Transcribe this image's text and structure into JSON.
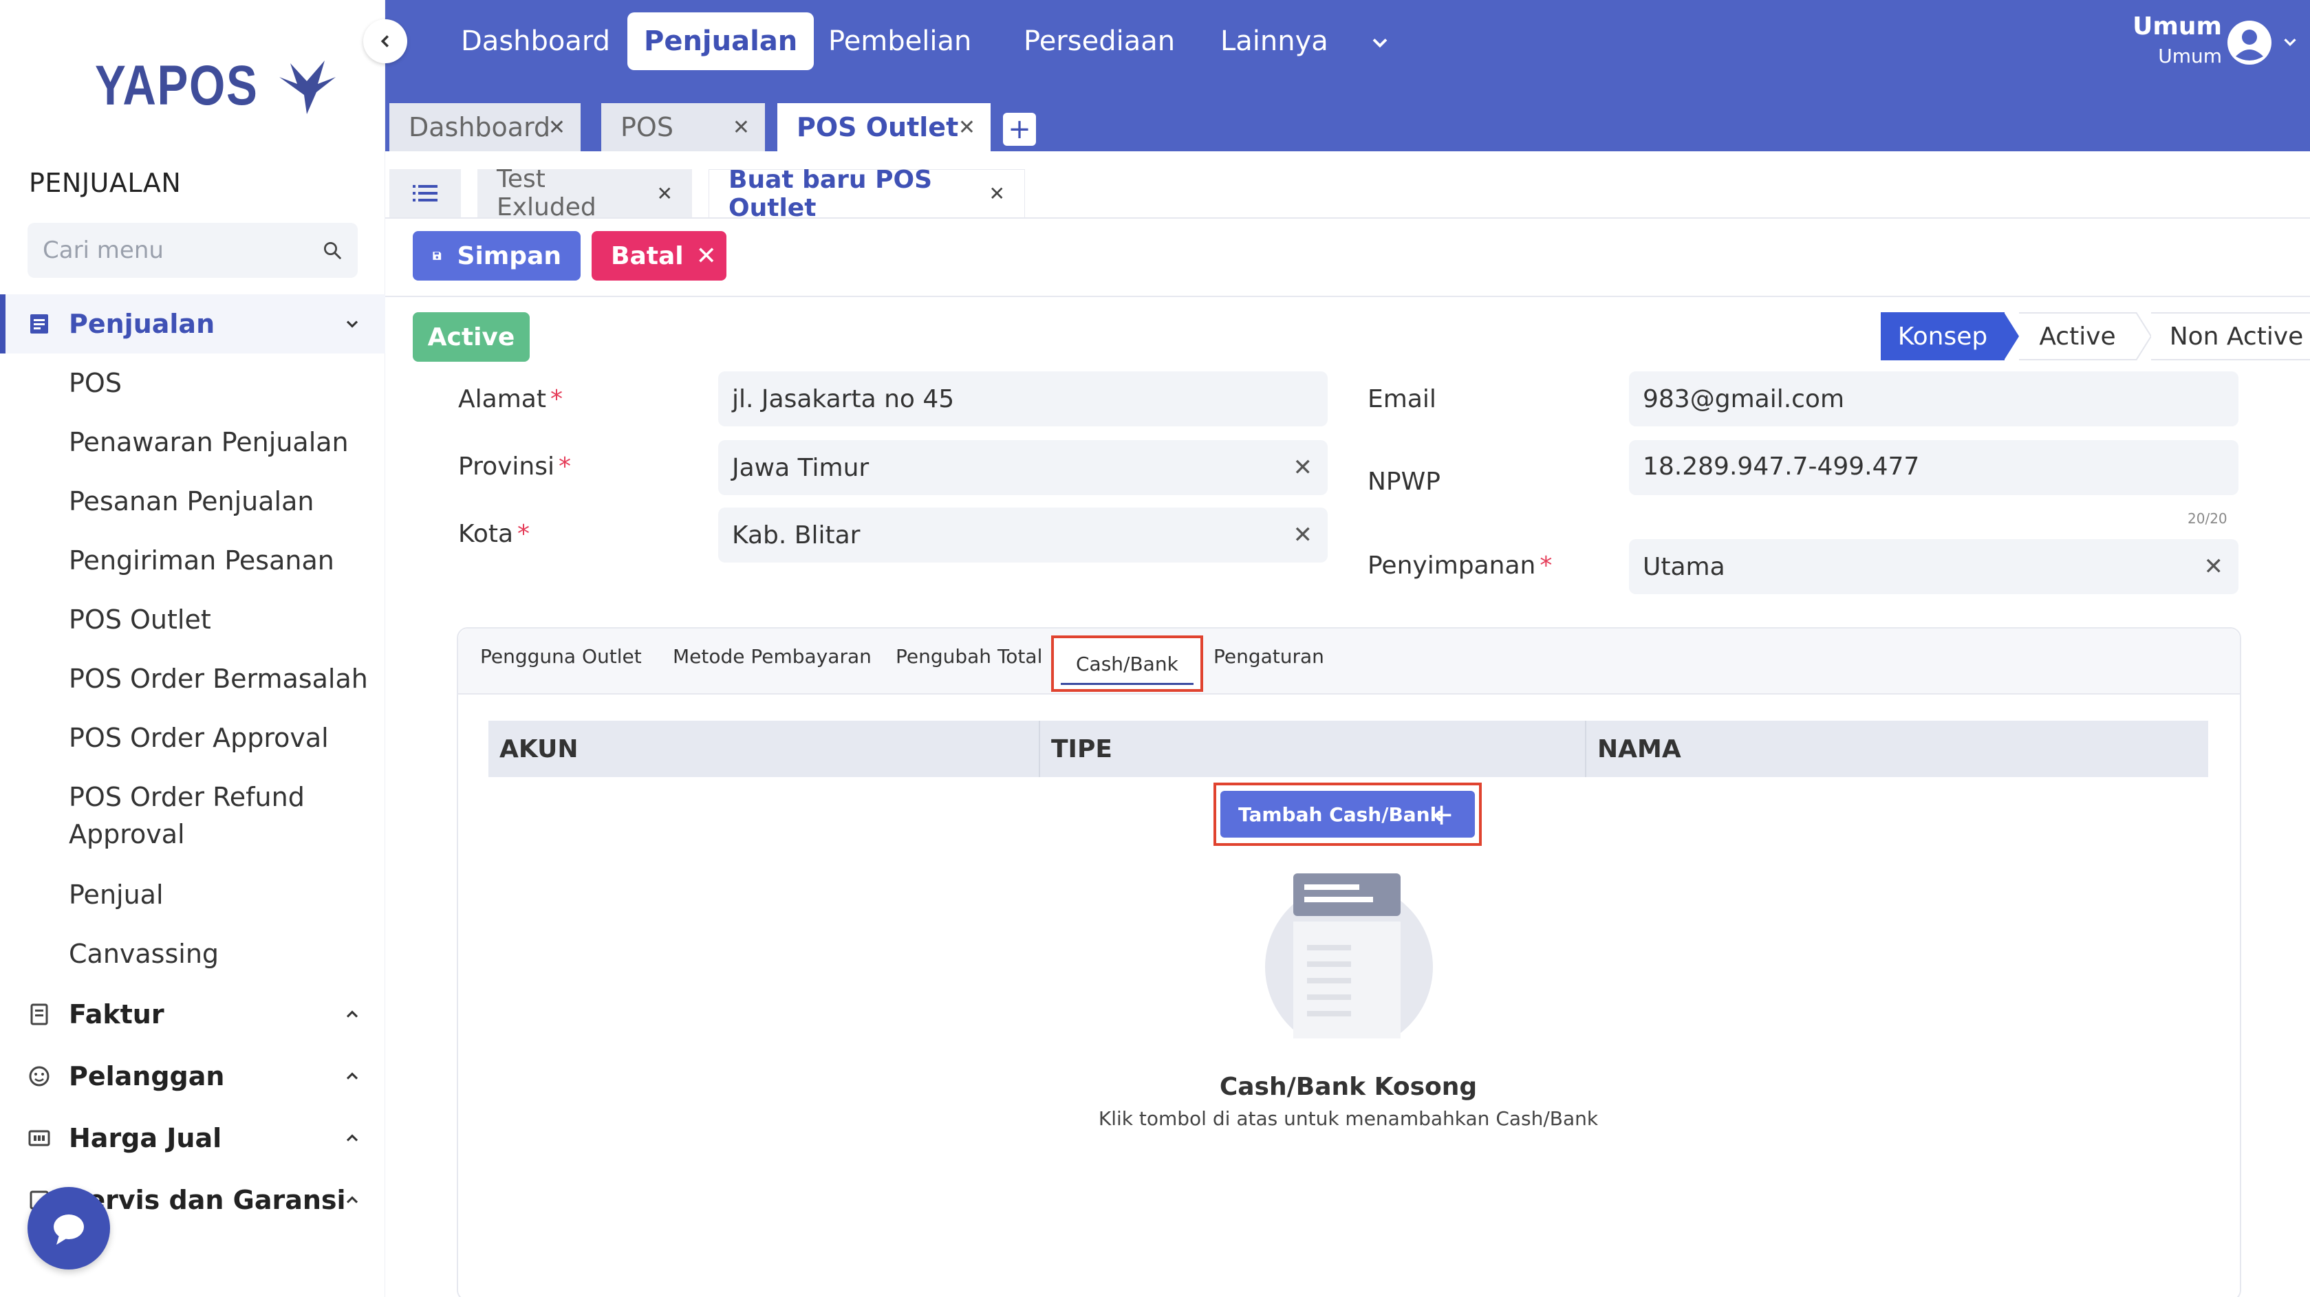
{
  "app": {
    "logo_text": "YAPOS"
  },
  "sidebar": {
    "section_title": "PENJUALAN",
    "search_placeholder": "Cari menu",
    "groups": [
      {
        "label": "Penjualan",
        "expanded": true
      },
      {
        "label": "Faktur",
        "expanded": false
      },
      {
        "label": "Pelanggan",
        "expanded": false
      },
      {
        "label": "Harga Jual",
        "expanded": false
      },
      {
        "label": "Servis dan Garansi",
        "expanded": false
      }
    ],
    "submenu": [
      "POS",
      "Penawaran Penjualan",
      "Pesanan Penjualan",
      "Pengiriman Pesanan",
      "POS Outlet",
      "POS Order Bermasalah",
      "POS Order Approval",
      "POS Order Refund",
      "Approval",
      "Penjual",
      "Canvassing"
    ]
  },
  "topnav": {
    "items": [
      "Dashboard",
      "Penjualan",
      "Pembelian",
      "Persediaan",
      "Lainnya"
    ],
    "active": "Penjualan",
    "user": {
      "name": "Umum",
      "role": "Umum"
    }
  },
  "window_tabs": [
    "Dashboard",
    "POS",
    "POS Outlet"
  ],
  "sub_tabs": [
    "Test Exluded",
    "Buat baru POS Outlet"
  ],
  "toolbar": {
    "save_label": "Simpan",
    "cancel_label": "Batal"
  },
  "status": {
    "badge": "Active",
    "steps": [
      "Konsep",
      "Active",
      "Non Active"
    ],
    "current_step": "Konsep"
  },
  "form": {
    "alamat": {
      "label": "Alamat",
      "value": "jl. Jasakarta no 45"
    },
    "provinsi": {
      "label": "Provinsi",
      "value": "Jawa Timur"
    },
    "kota": {
      "label": "Kota",
      "value": "Kab. Blitar"
    },
    "email": {
      "label": "Email",
      "value": "983@gmail.com"
    },
    "npwp": {
      "label": "NPWP",
      "value": "18.289.947.7-499.477",
      "counter": "20/20"
    },
    "penyimpanan": {
      "label": "Penyimpanan",
      "value": "Utama"
    }
  },
  "inner_tabs": [
    "Pengguna Outlet",
    "Metode Pembayaran",
    "Pengubah Total",
    "Cash/Bank",
    "Pengaturan"
  ],
  "inner_active": "Cash/Bank",
  "table": {
    "columns": [
      "AKUN",
      "TIPE",
      "NAMA"
    ]
  },
  "add_button": {
    "label": "Tambah Cash/Bank"
  },
  "empty_state": {
    "title": "Cash/Bank Kosong",
    "subtitle": "Klik tombol di atas untuk menambahkan Cash/Bank"
  },
  "colors": {
    "primary": "#4f63c4",
    "button_primary": "#5a6fdc",
    "danger": "#e8306a",
    "success": "#5fbe8a",
    "highlight": "#e0432f"
  }
}
